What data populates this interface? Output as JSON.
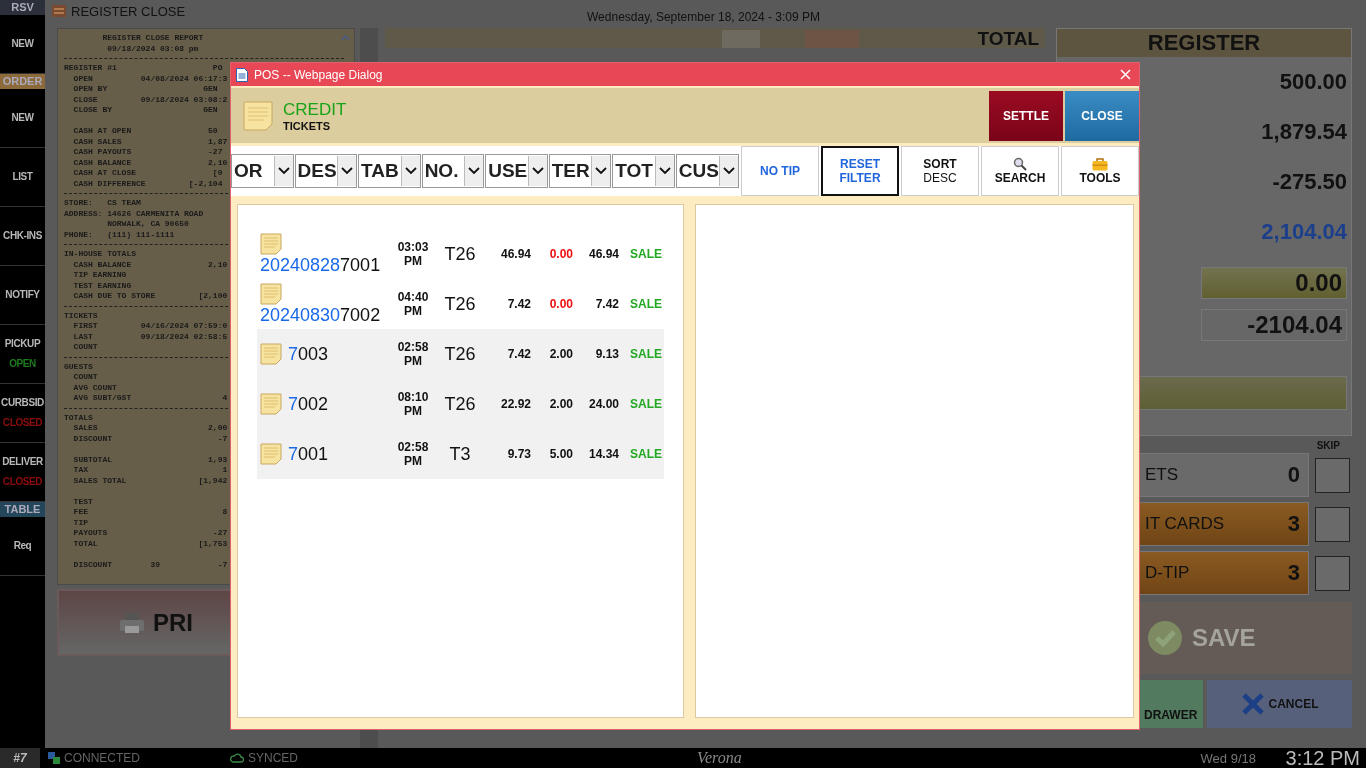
{
  "sidebar": [
    {
      "kind": "header",
      "label": "RSV",
      "color": "#2b303b"
    },
    {
      "kind": "item",
      "label": "NEW"
    },
    {
      "kind": "header",
      "label": "ORDER",
      "color": "#8c6a3a"
    },
    {
      "kind": "item",
      "label": "NEW"
    },
    {
      "kind": "item",
      "label": "LIST"
    },
    {
      "kind": "item",
      "label": "CHK-INS"
    },
    {
      "kind": "item",
      "label": "NOTIFY"
    },
    {
      "kind": "item",
      "label": "PICKUP",
      "status": "OPEN",
      "color": "#1e7a1e"
    },
    {
      "kind": "item",
      "label": "CURBSID",
      "status": "CLOSED",
      "color": "#8e0c0c"
    },
    {
      "kind": "item",
      "label": "DELIVER",
      "status": "CLOSED",
      "color": "#8e0c0c"
    },
    {
      "kind": "header",
      "label": "TABLE",
      "color": "#24465a"
    },
    {
      "kind": "item",
      "label": "Req"
    }
  ],
  "page_title": "REGISTER CLOSE",
  "datetime": "Wednesday, September 18, 2024 - 3:09 PM",
  "receipt": [
    {
      "kind": "text",
      "text": "        REGISTER CLOSE REPORT"
    },
    {
      "kind": "text",
      "text": "         09/18/2024 03:08 pm"
    },
    {
      "kind": "rule"
    },
    {
      "kind": "text",
      "text": "REGISTER #1                    PO"
    },
    {
      "kind": "text",
      "text": "  OPEN          04/08/2024 06:17:3"
    },
    {
      "kind": "text",
      "text": "  OPEN BY                    GEN"
    },
    {
      "kind": "text",
      "text": "  CLOSE         09/18/2024 03:08:2"
    },
    {
      "kind": "text",
      "text": "  CLOSE BY                   GEN"
    },
    {
      "kind": "gap"
    },
    {
      "kind": "text",
      "text": "  CASH AT OPEN                50"
    },
    {
      "kind": "text",
      "text": "  CASH SALES                  1,87"
    },
    {
      "kind": "text",
      "text": "  CASH PAYOUTS                -27"
    },
    {
      "kind": "text",
      "text": "  CASH BALANCE                2,10"
    },
    {
      "kind": "text",
      "text": "  CASH AT CLOSE                [0"
    },
    {
      "kind": "text",
      "text": "  CASH DIFFERENCE         [-2,104"
    },
    {
      "kind": "rule"
    },
    {
      "kind": "text",
      "text": "STORE:   CS TEAM"
    },
    {
      "kind": "text",
      "text": "ADDRESS: 14626 CARMENITA ROAD"
    },
    {
      "kind": "text",
      "text": "         NORWALK, CA 90650"
    },
    {
      "kind": "text",
      "text": "PHONE:   (111) 111-1111"
    },
    {
      "kind": "rule"
    },
    {
      "kind": "text",
      "text": "IN-HOUSE TOTALS"
    },
    {
      "kind": "text",
      "text": "  CASH BALANCE                2,10"
    },
    {
      "kind": "text",
      "text": "  TIP EARNING"
    },
    {
      "kind": "text",
      "text": "  TEST EARNING"
    },
    {
      "kind": "text",
      "text": "  CASH DUE TO STORE         [2,100"
    },
    {
      "kind": "rule"
    },
    {
      "kind": "text",
      "text": "TICKETS"
    },
    {
      "kind": "text",
      "text": "  FIRST         04/16/2024 07:59:0"
    },
    {
      "kind": "text",
      "text": "  LAST          09/18/2024 02:58:5"
    },
    {
      "kind": "text",
      "text": "  COUNT"
    },
    {
      "kind": "rule"
    },
    {
      "kind": "text",
      "text": "GUESTS"
    },
    {
      "kind": "text",
      "text": "  COUNT"
    },
    {
      "kind": "text",
      "text": "  AVG COUNT"
    },
    {
      "kind": "text",
      "text": "  AVG SUBT/GST                   4"
    },
    {
      "kind": "rule"
    },
    {
      "kind": "text",
      "text": "TOTALS"
    },
    {
      "kind": "text",
      "text": "  SALES                       2,00"
    },
    {
      "kind": "text",
      "text": "  DISCOUNT                      -7"
    },
    {
      "kind": "gap"
    },
    {
      "kind": "text",
      "text": "  SUBTOTAL                    1,93"
    },
    {
      "kind": "text",
      "text": "  TAX                            1"
    },
    {
      "kind": "text",
      "text": "  SALES TOTAL               [1,942"
    },
    {
      "kind": "gap"
    },
    {
      "kind": "text",
      "text": "  TEST"
    },
    {
      "kind": "text",
      "text": "  FEE                            8"
    },
    {
      "kind": "text",
      "text": "  TIP"
    },
    {
      "kind": "text",
      "text": "  PAYOUTS                      -27"
    },
    {
      "kind": "text",
      "text": "  TOTAL                     [1,753"
    },
    {
      "kind": "gap"
    },
    {
      "kind": "text",
      "text": "  DISCOUNT        39            -7"
    }
  ],
  "print_button": "PRI",
  "total_panel": {
    "title": "TOTAL"
  },
  "register": {
    "title": "REGISTER",
    "values": [
      {
        "text": "500.00",
        "kind": "plain"
      },
      {
        "text": "1,879.54",
        "kind": "plain"
      },
      {
        "text": "-275.50",
        "kind": "plain"
      },
      {
        "text": "2,104.04",
        "kind": "accent"
      },
      {
        "text": "0.00",
        "kind": "input"
      },
      {
        "text": "-2104.04",
        "kind": "field"
      }
    ],
    "skip_label": "SKIP",
    "counts": [
      {
        "label": "ETS",
        "count": "0",
        "kind": "plain",
        "checked": false
      },
      {
        "label": "IT CARDS",
        "count": "3",
        "kind": "orange",
        "checked": false
      },
      {
        "label": "D-TIP",
        "count": "3",
        "kind": "orange",
        "checked": false
      }
    ],
    "save": "SAVE",
    "open_drawer": "DRAWER",
    "cancel": "CANCEL"
  },
  "dialog": {
    "title": "POS -- Webpage Dialog",
    "heading": "CREDIT",
    "subheading": "TICKETS",
    "settle": "SETTLE",
    "close": "CLOSE",
    "filters": [
      "OR",
      "DES",
      "TAB",
      "NO.",
      "USE",
      "TER",
      "TOT",
      "CUS"
    ],
    "buttons": [
      {
        "label": "NO TIP",
        "kind": "filter",
        "highlighted": false
      },
      {
        "label": "RESET FILTER",
        "kind": "filter",
        "highlighted": true
      },
      {
        "label": "SORT",
        "sublabel": "DESC",
        "kind": "action",
        "highlighted": false
      },
      {
        "label": "SEARCH",
        "kind": "search",
        "highlighted": false
      },
      {
        "label": "TOOLS",
        "kind": "tools",
        "highlighted": false
      }
    ],
    "tickets": [
      {
        "prefix": "20240828",
        "number": "7001",
        "time": "03:03 PM",
        "table": "T26",
        "amount": "46.94",
        "tip": "0.00",
        "tip_alert": true,
        "total": "46.94",
        "type": "SALE",
        "shaded": false
      },
      {
        "prefix": "20240830",
        "number": "7002",
        "time": "04:40 PM",
        "table": "T26",
        "amount": "7.42",
        "tip": "0.00",
        "tip_alert": true,
        "total": "7.42",
        "type": "SALE",
        "shaded": false
      },
      {
        "prefix": "7",
        "number": "003",
        "time": "02:58 PM",
        "table": "T26",
        "amount": "7.42",
        "tip": "2.00",
        "tip_alert": false,
        "total": "9.13",
        "type": "SALE",
        "shaded": true
      },
      {
        "prefix": "7",
        "number": "002",
        "time": "08:10 PM",
        "table": "T26",
        "amount": "22.92",
        "tip": "2.00",
        "tip_alert": false,
        "total": "24.00",
        "type": "SALE",
        "shaded": true
      },
      {
        "prefix": "7",
        "number": "001",
        "time": "02:58 PM",
        "table": "T3",
        "amount": "9.73",
        "tip": "5.00",
        "tip_alert": false,
        "total": "14.34",
        "type": "SALE",
        "shaded": true
      }
    ]
  },
  "status_bar": {
    "station": "#7",
    "connection": "CONNECTED",
    "sync": "SYNCED",
    "location": "Verona",
    "date": "Wed 9/18",
    "time": "3:12 PM"
  }
}
